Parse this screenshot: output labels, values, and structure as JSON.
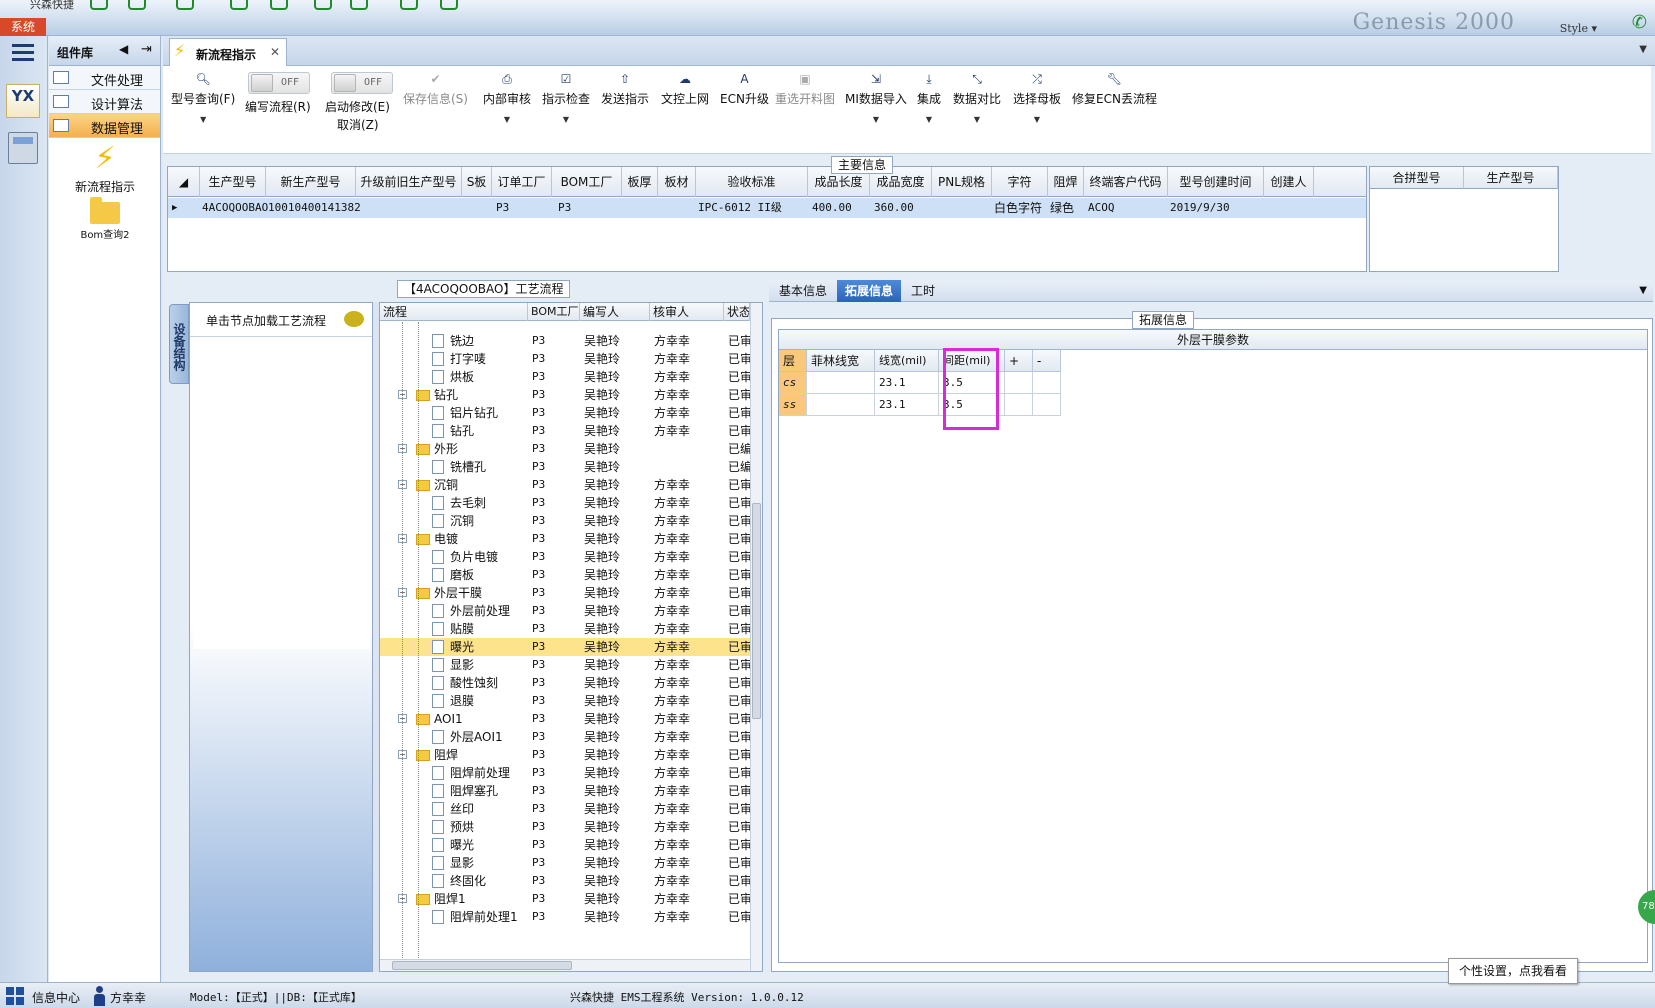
{
  "app": {
    "title": "兴森快捷",
    "system_menu": "系统",
    "style_label": "Style",
    "banner": "Genesis 2000"
  },
  "complib": {
    "title": "组件库",
    "categories": [
      "文件处理",
      "设计算法",
      "数据管理"
    ],
    "tools": [
      "新流程指示",
      "Bom查询2"
    ]
  },
  "tab": {
    "label": "新流程指示"
  },
  "toolbar": {
    "query_label": "型号查询(F)",
    "edit_flow_toggle": "OFF",
    "edit_flow_label": "编写流程(R)",
    "enable_edit_toggle": "OFF",
    "enable_edit_label": "启动修改(E)",
    "cancel_label": "取消(Z)",
    "save_label": "保存信息(S)",
    "internal_review": "内部审核",
    "check_instruction": "指示检查",
    "send_instruction": "发送指示",
    "upload_doc": "文控上网",
    "ecn_upgrade": "ECN升级",
    "resend_drawing": "重选开料图",
    "mi_import": "MI数据导入",
    "integrate": "集成",
    "data_compare": "数据对比",
    "select_master": "选择母板",
    "fix_ecn": "修复ECN丢流程"
  },
  "main_info": {
    "title": "主要信息",
    "headers": [
      "生产型号",
      "新生产型号",
      "升级前旧生产型号",
      "S板",
      "订单工厂",
      "BOM工厂",
      "板厚",
      "板材",
      "验收标准",
      "成品长度",
      "成品宽度",
      "PNL规格",
      "字符",
      "阻焊",
      "终端客户代码",
      "型号创建时间",
      "创建人"
    ],
    "row": [
      "4ACOQOOBAO",
      "10010400141382",
      "",
      "",
      "P3",
      "P3",
      "",
      "",
      "IPC-6012 II级",
      "400.00",
      "360.00",
      "",
      "白色字符",
      "绿色",
      "ACOQ",
      "2019/9/30",
      ""
    ],
    "side_headers": [
      "合拼型号",
      "生产型号"
    ]
  },
  "process": {
    "title": "【4ACOQOOBAO】工艺流程",
    "side_tab": "设备结构",
    "hint": "单击节点加载工艺流程",
    "headers": [
      "流程",
      "BOM工厂",
      "编写人",
      "核审人",
      "状态"
    ],
    "rows": [
      {
        "name": "铣边",
        "bom": "P3",
        "writer": "吴艳玲",
        "reviewer": "方幸幸",
        "status": "已审"
      },
      {
        "name": "打字唛",
        "bom": "P3",
        "writer": "吴艳玲",
        "reviewer": "方幸幸",
        "status": "已审"
      },
      {
        "name": "烘板",
        "bom": "P3",
        "writer": "吴艳玲",
        "reviewer": "方幸幸",
        "status": "已审"
      },
      {
        "name": "钻孔",
        "bom": "P3",
        "writer": "吴艳玲",
        "reviewer": "方幸幸",
        "status": "已审"
      },
      {
        "name": "铝片钻孔",
        "bom": "P3",
        "writer": "吴艳玲",
        "reviewer": "方幸幸",
        "status": "已审"
      },
      {
        "name": "钻孔",
        "bom": "P3",
        "writer": "吴艳玲",
        "reviewer": "方幸幸",
        "status": "已审"
      },
      {
        "name": "外形",
        "bom": "P3",
        "writer": "吴艳玲",
        "reviewer": "",
        "status": "已编"
      },
      {
        "name": "铣槽孔",
        "bom": "P3",
        "writer": "吴艳玲",
        "reviewer": "",
        "status": "已编"
      },
      {
        "name": "沉铜",
        "bom": "P3",
        "writer": "吴艳玲",
        "reviewer": "方幸幸",
        "status": "已审"
      },
      {
        "name": "去毛刺",
        "bom": "P3",
        "writer": "吴艳玲",
        "reviewer": "方幸幸",
        "status": "已审"
      },
      {
        "name": "沉铜",
        "bom": "P3",
        "writer": "吴艳玲",
        "reviewer": "方幸幸",
        "status": "已审"
      },
      {
        "name": "电镀",
        "bom": "P3",
        "writer": "吴艳玲",
        "reviewer": "方幸幸",
        "status": "已审"
      },
      {
        "name": "负片电镀",
        "bom": "P3",
        "writer": "吴艳玲",
        "reviewer": "方幸幸",
        "status": "已审"
      },
      {
        "name": "磨板",
        "bom": "P3",
        "writer": "吴艳玲",
        "reviewer": "方幸幸",
        "status": "已审"
      },
      {
        "name": "外层干膜",
        "bom": "P3",
        "writer": "吴艳玲",
        "reviewer": "方幸幸",
        "status": "已审"
      },
      {
        "name": "外层前处理",
        "bom": "P3",
        "writer": "吴艳玲",
        "reviewer": "方幸幸",
        "status": "已审"
      },
      {
        "name": "贴膜",
        "bom": "P3",
        "writer": "吴艳玲",
        "reviewer": "方幸幸",
        "status": "已审"
      },
      {
        "name": "曝光",
        "bom": "P3",
        "writer": "吴艳玲",
        "reviewer": "方幸幸",
        "status": "已审"
      },
      {
        "name": "显影",
        "bom": "P3",
        "writer": "吴艳玲",
        "reviewer": "方幸幸",
        "status": "已审"
      },
      {
        "name": "酸性蚀刻",
        "bom": "P3",
        "writer": "吴艳玲",
        "reviewer": "方幸幸",
        "status": "已审"
      },
      {
        "name": "退膜",
        "bom": "P3",
        "writer": "吴艳玲",
        "reviewer": "方幸幸",
        "status": "已审"
      },
      {
        "name": "AOI1",
        "bom": "P3",
        "writer": "吴艳玲",
        "reviewer": "方幸幸",
        "status": "已审"
      },
      {
        "name": "外层AOI1",
        "bom": "P3",
        "writer": "吴艳玲",
        "reviewer": "方幸幸",
        "status": "已审"
      },
      {
        "name": "阻焊",
        "bom": "P3",
        "writer": "吴艳玲",
        "reviewer": "方幸幸",
        "status": "已审"
      },
      {
        "name": "阻焊前处理",
        "bom": "P3",
        "writer": "吴艳玲",
        "reviewer": "方幸幸",
        "status": "已审"
      },
      {
        "name": "阻焊塞孔",
        "bom": "P3",
        "writer": "吴艳玲",
        "reviewer": "方幸幸",
        "status": "已审"
      },
      {
        "name": "丝印",
        "bom": "P3",
        "writer": "吴艳玲",
        "reviewer": "方幸幸",
        "status": "已审"
      },
      {
        "name": "预烘",
        "bom": "P3",
        "writer": "吴艳玲",
        "reviewer": "方幸幸",
        "status": "已审"
      },
      {
        "name": "曝光",
        "bom": "P3",
        "writer": "吴艳玲",
        "reviewer": "方幸幸",
        "status": "已审"
      },
      {
        "name": "显影",
        "bom": "P3",
        "writer": "吴艳玲",
        "reviewer": "方幸幸",
        "status": "已审"
      },
      {
        "name": "终固化",
        "bom": "P3",
        "writer": "吴艳玲",
        "reviewer": "方幸幸",
        "status": "已审"
      },
      {
        "name": "阻焊1",
        "bom": "P3",
        "writer": "吴艳玲",
        "reviewer": "方幸幸",
        "status": "已审"
      },
      {
        "name": "阻焊前处理1",
        "bom": "P3",
        "writer": "吴艳玲",
        "reviewer": "方幸幸",
        "status": "已审"
      }
    ]
  },
  "detail": {
    "tabs": [
      "基本信息",
      "拓展信息",
      "工时"
    ],
    "group_title": "拓展信息",
    "caption": "外层干膜参数",
    "headers": [
      "层",
      "菲林线宽",
      "线宽(mil)",
      "间距(mil)",
      "+",
      "-"
    ],
    "rows": [
      {
        "layer": "cs",
        "film": "",
        "width": "23.1",
        "spacing": "3.5"
      },
      {
        "layer": "ss",
        "film": "",
        "width": "23.1",
        "spacing": "3.5"
      }
    ]
  },
  "status": {
    "info_center": "信息中心",
    "user": "方幸幸",
    "model_db": "Model:【正式】||DB:【正式库】",
    "version": "兴森快捷 EMS工程系统 Version: 1.0.0.12",
    "tooltip": "个性设置，点我看看",
    "badge": "78"
  }
}
